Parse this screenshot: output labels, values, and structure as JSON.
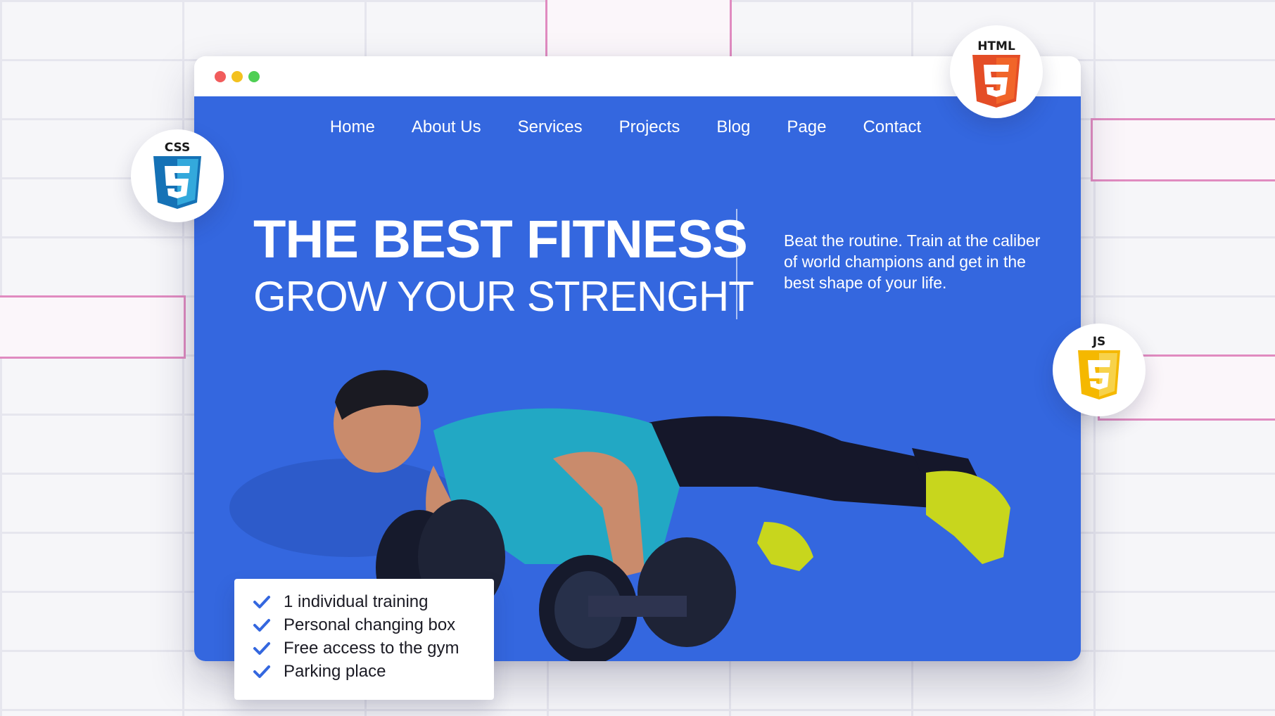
{
  "nav": {
    "items": [
      "Home",
      "About Us",
      "Services",
      "Projects",
      "Blog",
      "Page",
      "Contact"
    ]
  },
  "hero": {
    "title": "THE BEST FITNESS",
    "subtitle": "GROW YOUR STRENGHT",
    "description": "Beat the routine. Train at the caliber of world champions and get in the best shape of your life."
  },
  "features": [
    "1 individual training",
    "Personal changing box",
    "Free access to the gym",
    "Parking place"
  ],
  "badges": {
    "html": "HTML",
    "css": "CSS",
    "js": "JS"
  },
  "colors": {
    "hero_bg": "#3467df",
    "check": "#3467df",
    "html": "#e44d26",
    "css": "#1f88e5",
    "js": "#f5b800",
    "grid_accent": "#e08bc0"
  }
}
